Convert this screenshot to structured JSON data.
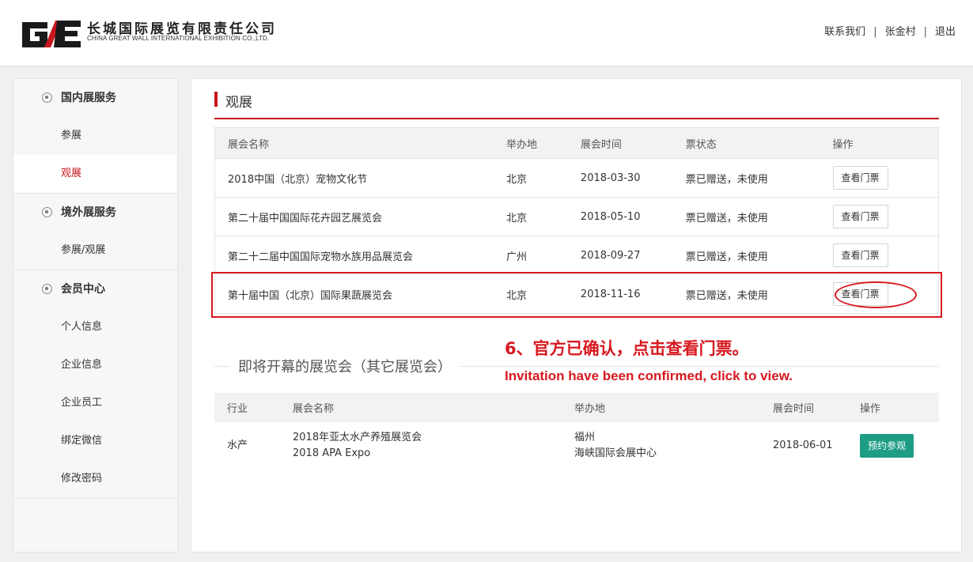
{
  "header": {
    "logo_mark": "GE",
    "logo_cn": "长城国际展览有限责任公司",
    "logo_en": "CHINA GREAT WALL INTERNATIONAL EXHIBITION CO.,LTD.",
    "nav": [
      "联系我们",
      "张金村",
      "退出"
    ],
    "nav_separator": "|"
  },
  "sidebar": {
    "groups": [
      {
        "title": "国内展服务",
        "items": [
          "参展",
          "观展"
        ]
      },
      {
        "title": "境外展服务",
        "items": [
          "参展/观展"
        ]
      },
      {
        "title": "会员中心",
        "items": [
          "个人信息",
          "企业信息",
          "企业员工",
          "绑定微信",
          "修改密码"
        ]
      }
    ],
    "active_item": "观展"
  },
  "main": {
    "section_title": "观展",
    "tickets_table": {
      "headers": [
        "展会名称",
        "举办地",
        "展会时间",
        "票状态",
        "操作"
      ],
      "rows": [
        {
          "name": "2018中国（北京）宠物文化节",
          "city": "北京",
          "date": "2018-03-30",
          "status": "票已赠送，未使用",
          "action": "查看门票"
        },
        {
          "name": "第二十届中国国际花卉园艺展览会",
          "city": "北京",
          "date": "2018-05-10",
          "status": "票已赠送，未使用",
          "action": "查看门票"
        },
        {
          "name": "第二十二届中国国际宠物水族用品展览会",
          "city": "广州",
          "date": "2018-09-27",
          "status": "票已赠送，未使用",
          "action": "查看门票"
        },
        {
          "name": "第十届中国（北京）国际果蔬展览会",
          "city": "北京",
          "date": "2018-11-16",
          "status": "票已赠送，未使用",
          "action": "查看门票"
        }
      ]
    },
    "annotation": {
      "cn": "6、官方已确认，点击查看门票。",
      "en": "Invitation have been confirmed, click to view.",
      "color": "#d7181f"
    },
    "upcoming": {
      "title": "即将开幕的展览会（其它展览会）",
      "headers": [
        "行业",
        "展会名称",
        "举办地",
        "展会时间",
        "操作"
      ],
      "rows": [
        {
          "industry": "水产",
          "name_cn": "2018年亚太水产养殖展览会",
          "name_en": "2018 APA Expo",
          "city": "福州",
          "venue": "海峡国际会展中心",
          "date": "2018-06-01",
          "action": "预约参观"
        }
      ]
    }
  },
  "colors": {
    "accent": "#c8161d",
    "button_green": "#1e9d85"
  }
}
